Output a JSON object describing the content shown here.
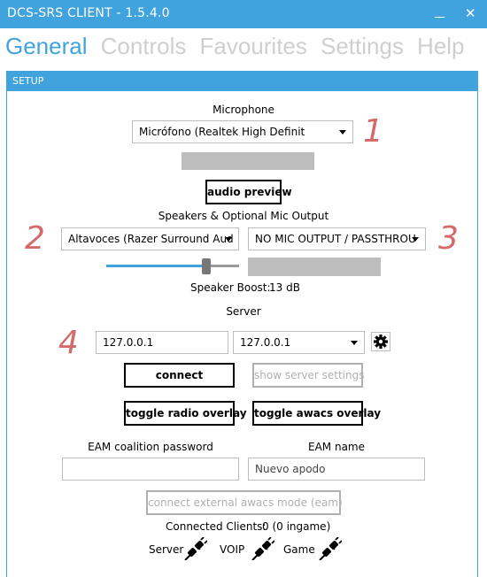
{
  "window": {
    "title": "DCS-SRS CLIENT - 1.5.4.0",
    "minimize": "—",
    "close": "✕"
  },
  "tabs": [
    "General",
    "Controls",
    "Favourites",
    "Settings",
    "Help"
  ],
  "setup": {
    "header": "SETUP",
    "microphone_label": "Microphone",
    "microphone_value": "Micrófono (Realtek High Definit",
    "audio_preview": "audio preview",
    "speakers_label": "Speakers & Optional Mic Output",
    "speakers_value": "Altavoces (Razer Surround Aud",
    "mic_output_value": "NO MIC OUTPUT / PASSTHROU",
    "speaker_boost_label": "Speaker Boost:",
    "speaker_boost_value": "13 dB",
    "speaker_boost_level": 0.73,
    "server_label": "Server",
    "server_address": "127.0.0.1",
    "server_select": "127.0.0.1",
    "connect": "connect",
    "show_server_settings": "show server settings",
    "toggle_radio_overlay": "toggle radio overlay",
    "toggle_awacs_overlay": "toggle awacs overlay",
    "eam_password_label": "EAM coalition password",
    "eam_password_value": "",
    "eam_name_label": "EAM name",
    "eam_name_value": "Nuevo apodo",
    "connect_eam": "connect external awacs mode (eam)",
    "connected_clients_label": "Connected Clients:",
    "connected_clients_value": "0 (0 ingame)",
    "status_server": "Server",
    "status_voip": "VOIP",
    "status_game": "Game"
  },
  "annotations": [
    "1",
    "2",
    "3",
    "4"
  ],
  "colors": {
    "accent": "#41a3de",
    "annotation": "#d46a6a",
    "disabled": "#b0b0b0"
  },
  "icons": {
    "gear": "gear-icon",
    "plug": "disconnected-plug-icon"
  }
}
